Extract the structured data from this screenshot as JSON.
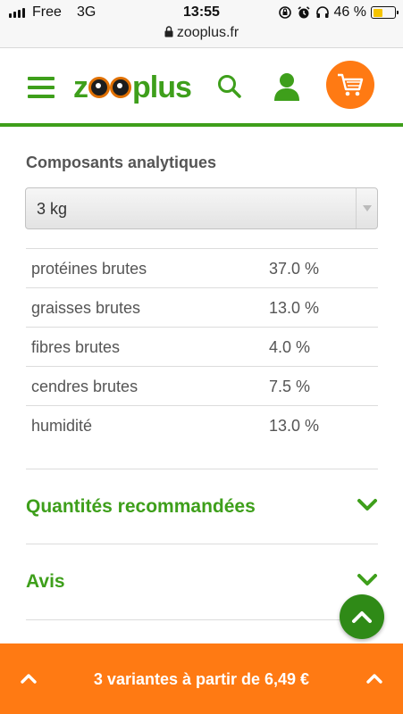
{
  "status_bar": {
    "carrier": "Free",
    "network": "3G",
    "time": "13:55",
    "battery_text": "46 %",
    "battery_level": 0.46,
    "url": "zooplus.fr"
  },
  "header": {
    "logo_prefix": "z",
    "logo_suffix": "plus",
    "accent_color": "#3e9f1b",
    "cart_color": "#ff7a13",
    "icons": [
      "hamburger-menu-icon",
      "search-icon",
      "user-icon",
      "cart-icon"
    ]
  },
  "analytics": {
    "title": "Composants analytiques",
    "select_value": "3 kg",
    "rows": [
      {
        "name": "protéines brutes",
        "value": "37.0 %"
      },
      {
        "name": "graisses brutes",
        "value": "13.0 %"
      },
      {
        "name": "fibres brutes",
        "value": "4.0 %"
      },
      {
        "name": "cendres brutes",
        "value": "7.5 %"
      },
      {
        "name": "humidité",
        "value": "13.0 %"
      }
    ]
  },
  "accordions": [
    {
      "label": "Quantités recommandées"
    },
    {
      "label": "Avis"
    }
  ],
  "footer": {
    "text": "3 variantes à partir de 6,49 €"
  }
}
